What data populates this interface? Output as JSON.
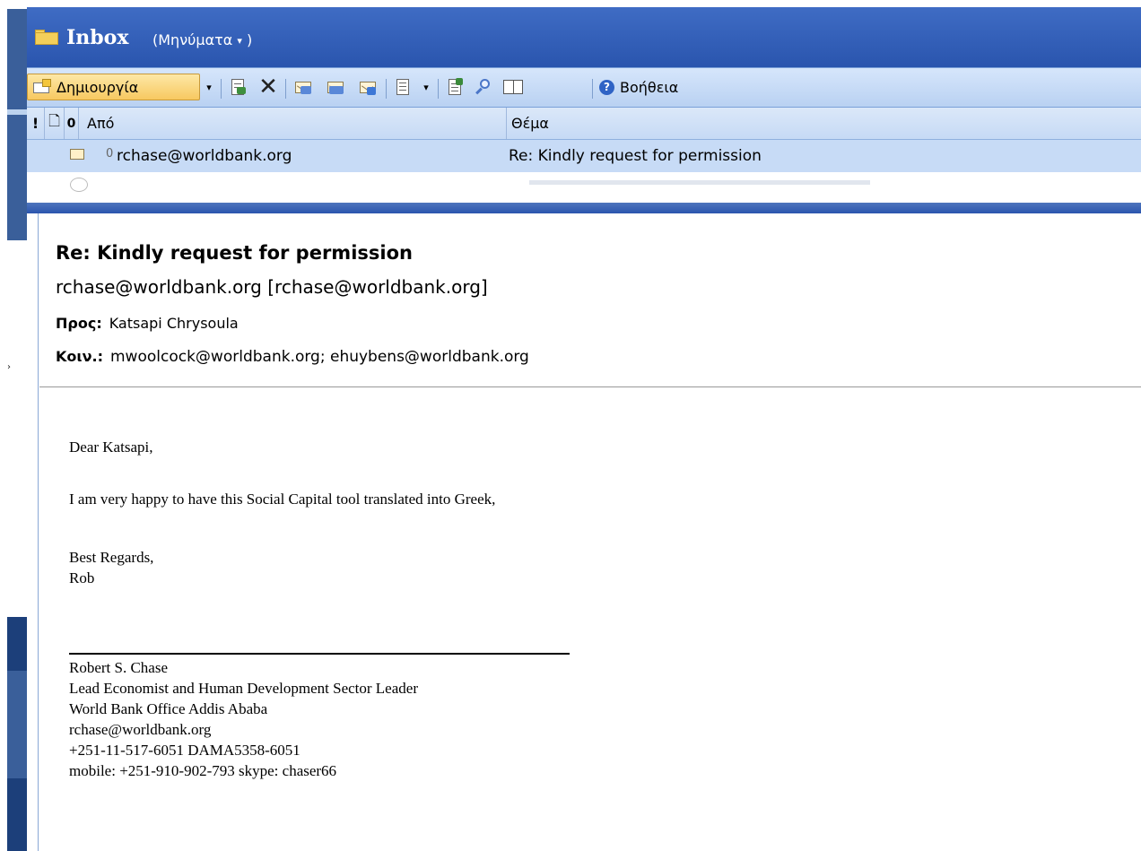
{
  "folder": {
    "title": "Inbox",
    "view_label": "(Μηνύματα",
    "view_caret": "▾",
    "view_close": ")"
  },
  "toolbar": {
    "new_label": "Δημιουργία",
    "new_dropdown": "▾",
    "view_dropdown": "▾",
    "help_label": "Βοήθεια",
    "help_glyph": "?",
    "delete_glyph": "✕"
  },
  "columns": {
    "importance": "!",
    "type": "🗋",
    "attachment": "0",
    "from": "Από",
    "subject": "Θέμα"
  },
  "messages": [
    {
      "from": "rchase@worldbank.org",
      "subject": "Re: Kindly request for permission",
      "has_attachment": true,
      "attachment_glyph": "0",
      "selected": true
    }
  ],
  "reading": {
    "subject": "Re: Kindly request for permission",
    "sender": "rchase@worldbank.org [rchase@worldbank.org]",
    "to_label": "Προς:",
    "to_value": "Katsapi Chrysoula",
    "cc_label": "Κοιν.:",
    "cc_value": "mwoolcock@worldbank.org; ehuybens@worldbank.org",
    "body": {
      "greeting": "Dear Katsapi,",
      "paragraph": "I am very happy to have this Social Capital tool translated into Greek,",
      "closing": "Best Regards,",
      "name": "Rob"
    },
    "signature": {
      "name": "Robert S. Chase",
      "title": "Lead Economist and Human Development Sector Leader",
      "office": "World Bank Office Addis Ababa",
      "email": "rchase@worldbank.org",
      "phone": "+251-11-517-6051 DAMA5358-6051",
      "mobile": "mobile: +251-910-902-793 skype: chaser66"
    }
  },
  "colors": {
    "title_bar": "#2a55ae",
    "toolbar": "#c6daf5",
    "new_button": "#f7c860",
    "selected_row": "#c7dbf6"
  }
}
